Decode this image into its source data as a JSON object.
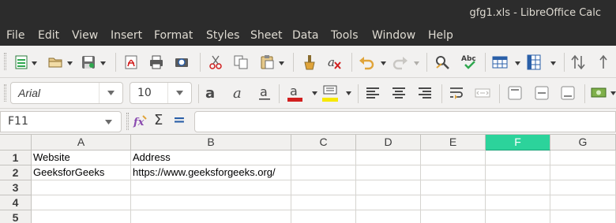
{
  "window": {
    "title": "gfg1.xls - LibreOffice Calc"
  },
  "menu": [
    "File",
    "Edit",
    "View",
    "Insert",
    "Format",
    "Styles",
    "Sheet",
    "Data",
    "Tools",
    "Window",
    "Help"
  ],
  "toolbar": {
    "icons": [
      "new-spreadsheet-icon",
      "open-folder-icon",
      "save-icon",
      "export-pdf-icon",
      "print-icon",
      "print-preview-icon",
      "cut-icon",
      "copy-icon",
      "paste-icon",
      "clone-formatting-icon",
      "clear-formatting-icon",
      "undo-icon",
      "redo-icon",
      "find-replace-icon",
      "spellcheck-icon",
      "row-icon",
      "column-icon",
      "sort-icon"
    ],
    "spellcheck_label": "Abc"
  },
  "formatting": {
    "font_name": "Arial",
    "font_size": "10",
    "font_color": "#d11f1f",
    "highlight_color": "#f7e800",
    "icons": [
      "bold-icon",
      "italic-icon",
      "underline-icon",
      "font-color-icon",
      "highlight-icon",
      "align-left-icon",
      "align-center-icon",
      "align-right-icon",
      "wrap-text-icon",
      "merge-cells-icon",
      "align-top-icon",
      "align-middle-icon",
      "align-bottom-icon",
      "currency-icon"
    ]
  },
  "formula_bar": {
    "name_box": "F11",
    "function_wizard_label": "fx",
    "sum_label": "Σ",
    "formula_label": "=",
    "content": ""
  },
  "sheet": {
    "selected_column": "F",
    "selected_color": "#2cd39b",
    "columns": [
      "A",
      "B",
      "C",
      "D",
      "E",
      "F",
      "G"
    ],
    "rows": [
      "1",
      "2",
      "3",
      "4",
      "5"
    ],
    "cells": [
      [
        "Website",
        "Address",
        "",
        "",
        "",
        "",
        ""
      ],
      [
        "GeeksforGeeks",
        "https://www.geeksforgeeks.org/",
        "",
        "",
        "",
        "",
        ""
      ],
      [
        "",
        "",
        "",
        "",
        "",
        "",
        ""
      ],
      [
        "",
        "",
        "",
        "",
        "",
        "",
        ""
      ],
      [
        "",
        "",
        "",
        "",
        "",
        "",
        ""
      ]
    ]
  }
}
